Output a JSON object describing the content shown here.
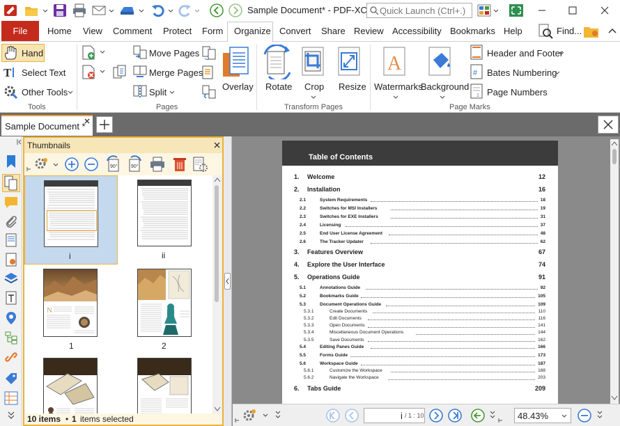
{
  "window": {
    "title": "Sample Document* - PDF-XCh..",
    "search_placeholder": "Quick Launch (Ctrl+.)"
  },
  "menu": {
    "file": "File",
    "tabs": [
      "Home",
      "View",
      "Comment",
      "Protect",
      "Form",
      "Organize",
      "Convert",
      "Share",
      "Review",
      "Accessibility",
      "Bookmarks",
      "Help"
    ],
    "find": "Find..."
  },
  "ribbon": {
    "tools": {
      "hand": "Hand",
      "select_text": "Select Text",
      "other_tools": "Other Tools",
      "group": "Tools"
    },
    "pages": {
      "move": "Move Pages",
      "merge": "Merge Pages",
      "split": "Split",
      "overlay": "Overlay",
      "group": "Pages"
    },
    "transform": {
      "rotate": "Rotate",
      "crop": "Crop",
      "resize": "Resize",
      "group": "Transform Pages"
    },
    "marks": {
      "watermarks": "Watermarks",
      "background": "Background",
      "header_footer": "Header and Footer",
      "bates": "Bates Numbering",
      "page_numbers": "Page Numbers",
      "group": "Page Marks"
    }
  },
  "doc_tab": {
    "title": "Sample Document *"
  },
  "thumbnails": {
    "title": "Thumbnails",
    "labels": [
      "i",
      "ii",
      "1",
      "2"
    ],
    "status_count": "10 items",
    "status_selected_num": "1",
    "status_selected": "items selected"
  },
  "page_content": {
    "heading": "Table of Contents",
    "entries": [
      {
        "num": "1.",
        "title": "Welcome",
        "page": "12",
        "level": 1
      },
      {
        "num": "2.",
        "title": "Installation",
        "page": "16",
        "level": 1
      },
      {
        "num": "2.1",
        "title": "System Requirements",
        "page": "18",
        "level": 2
      },
      {
        "num": "2.2",
        "title": "Switches for MSI Installers",
        "page": "19",
        "level": 2
      },
      {
        "num": "2.3",
        "title": "Switches for EXE Installers",
        "page": "31",
        "level": 2
      },
      {
        "num": "2.4",
        "title": "Licensing",
        "page": "37",
        "level": 2
      },
      {
        "num": "2.5",
        "title": "End User License Agreement",
        "page": "48",
        "level": 2
      },
      {
        "num": "2.6",
        "title": "The Tracker Updater",
        "page": "62",
        "level": 2
      },
      {
        "num": "3.",
        "title": "Features Overview",
        "page": "67",
        "level": 1
      },
      {
        "num": "4.",
        "title": "Explore the User Interface",
        "page": "74",
        "level": 1
      },
      {
        "num": "5.",
        "title": "Operations Guide",
        "page": "91",
        "level": 1
      },
      {
        "num": "5.1",
        "title": "Annotations Guide",
        "page": "92",
        "level": 2
      },
      {
        "num": "5.2",
        "title": "Bookmarks Guide",
        "page": "105",
        "level": 2
      },
      {
        "num": "5.3",
        "title": "Document Operations Guide",
        "page": "109",
        "level": 2
      },
      {
        "num": "5.3.1",
        "title": "Create Documents",
        "page": "110",
        "level": 3
      },
      {
        "num": "5.3.2",
        "title": "Edit Documents",
        "page": "116",
        "level": 3
      },
      {
        "num": "5.3.3",
        "title": "Open Documents",
        "page": "141",
        "level": 3
      },
      {
        "num": "5.3.4",
        "title": "Miscellaneous Document Operations",
        "page": "144",
        "level": 3
      },
      {
        "num": "5.3.5",
        "title": "Save Documents",
        "page": "162",
        "level": 3
      },
      {
        "num": "5.4",
        "title": "Editing Panes Guide",
        "page": "166",
        "level": 2
      },
      {
        "num": "5.5",
        "title": "Forms Guide",
        "page": "173",
        "level": 2
      },
      {
        "num": "5.6",
        "title": "Workspace Guide",
        "page": "187",
        "level": 2
      },
      {
        "num": "5.6.1",
        "title": "Customize the Workspace",
        "page": "188",
        "level": 3
      },
      {
        "num": "5.6.2",
        "title": "Navigate the Workspace",
        "page": "203",
        "level": 3
      },
      {
        "num": "6.",
        "title": "Tabs Guide",
        "page": "209",
        "level": 1
      }
    ]
  },
  "nav": {
    "current_page": "i",
    "page_total": "/ 1 : 10",
    "zoom": "48.43%"
  },
  "colors": {
    "accent": "#c42b1c",
    "panel_border": "#e8b23a",
    "selected_thumb": "#c5d9ee"
  }
}
